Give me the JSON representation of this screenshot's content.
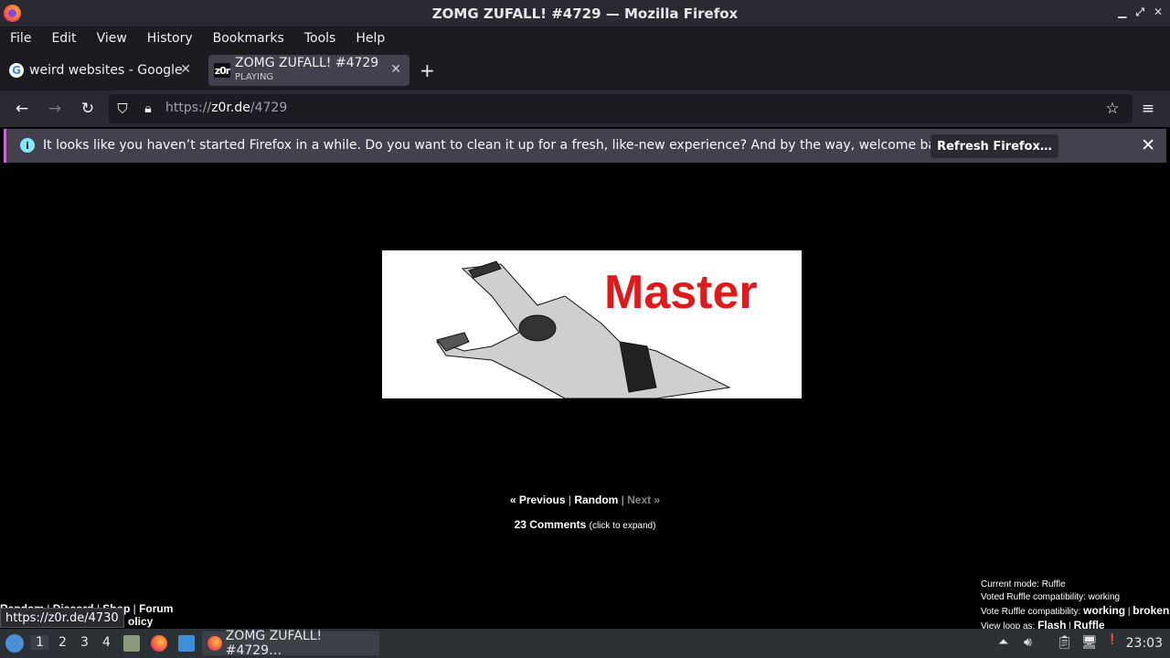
{
  "window": {
    "title": "ZOMG ZUFALL! #4729 — Mozilla Firefox"
  },
  "menu": [
    "File",
    "Edit",
    "View",
    "History",
    "Bookmarks",
    "Tools",
    "Help"
  ],
  "tabs": [
    {
      "title": "weird websites - Google",
      "favicon": "google-icon"
    },
    {
      "title": "ZOMG ZUFALL! #4729",
      "subtitle": "PLAYING",
      "favicon": "z0r-icon",
      "favicon_text": "z0r"
    }
  ],
  "urlbar": {
    "scheme": "https://",
    "host": "z0r.de",
    "path": "/4729"
  },
  "infobar": {
    "message": "It looks like you haven’t started Firefox in a while. Do you want to clean it up for a fresh, like-new experience? And by the way, welcome back!",
    "button": "Refresh Firefox…"
  },
  "banner": {
    "word": "Master",
    "word_color": "#e0191b"
  },
  "pagenav": {
    "previous": "« Previous",
    "random": "Random",
    "next": "Next »"
  },
  "comments": {
    "count_label": "23 Comments",
    "hint": "(click to expand)"
  },
  "footer": {
    "links": [
      "Random",
      "Discord",
      "Shop",
      "Forum"
    ],
    "second_line": "olicy"
  },
  "status_url": "https://z0r.de/4730",
  "mode_info": {
    "current_mode": "Current mode: Ruffle",
    "voted": "Voted Ruffle compatibility: working",
    "vote_label": "Vote Ruffle compatibility:",
    "vote_working": "working",
    "vote_broken": "broken",
    "loop_label": "View loop as:",
    "loop_flash": "Flash",
    "loop_ruffle": "Ruffle"
  },
  "taskbar": {
    "workspaces": [
      "1",
      "2",
      "3",
      "4"
    ],
    "active_task": "ZOMG ZUFALL! #4729…",
    "clock": "23:03"
  }
}
